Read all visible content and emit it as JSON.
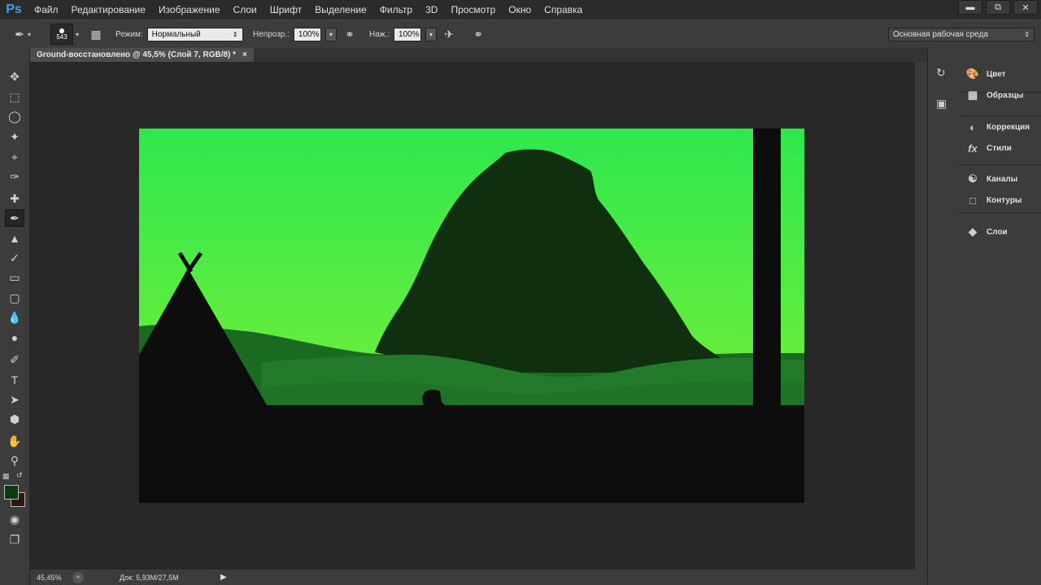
{
  "app": {
    "logo": "Ps"
  },
  "menu": [
    "Файл",
    "Редактирование",
    "Изображение",
    "Слои",
    "Шрифт",
    "Выделение",
    "Фильтр",
    "3D",
    "Просмотр",
    "Окно",
    "Справка"
  ],
  "window_controls": [
    "minimize-icon",
    "restore-icon",
    "close-icon"
  ],
  "options": {
    "brush_size": "543",
    "mode_label": "Режим:",
    "mode_value": "Нормальный",
    "opacity_label": "Непрозр.:",
    "opacity_value": "100%",
    "flow_label": "Наж.:",
    "flow_value": "100%",
    "workspace_value": "Основная рабочая среда"
  },
  "document": {
    "tab_title": "Ground-восстановлено @ 45,5% (Слой 7, RGB/8) *",
    "close_glyph": "×"
  },
  "status": {
    "zoom": "45,45%",
    "doc_info": "Док: 5,93M/27,5M"
  },
  "panels": [
    {
      "label": "Цвет",
      "icon": "color-icon"
    },
    {
      "label": "Образцы",
      "icon": "swatches-icon"
    },
    {
      "label": "Коррекция",
      "icon": "adjustments-icon"
    },
    {
      "label": "Стили",
      "icon": "styles-icon"
    },
    {
      "label": "Каналы",
      "icon": "channels-icon"
    },
    {
      "label": "Контуры",
      "icon": "paths-icon"
    },
    {
      "label": "Слои",
      "icon": "layers-icon"
    }
  ],
  "colors": {
    "foreground": "#0e3a12",
    "background": "#2a1a0e",
    "sky_top": "#2ee84e",
    "sky_bottom": "#72ee3a",
    "mountain": "#0f2f0f",
    "hill_far": "#1b6a22",
    "hill_near": "#227a2a",
    "ground": "#0d0d0d"
  }
}
